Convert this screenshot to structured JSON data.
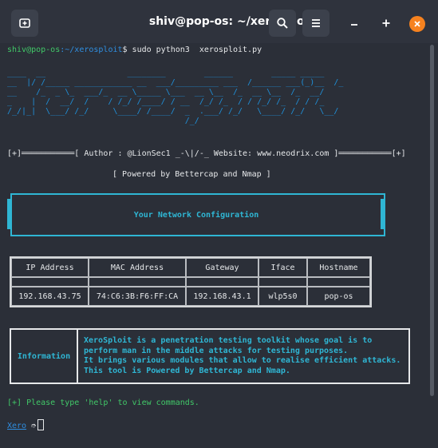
{
  "window": {
    "title": "shiv@pop-os: ~/xerosploit"
  },
  "header": {
    "new_tab_icon": "new-tab-icon",
    "search_icon": "search-icon",
    "menu_icon": "hamburger-menu-icon",
    "minimize_icon": "minimize-icon",
    "maximize_icon": "maximize-icon",
    "close_icon": "close-icon",
    "close_color": "#f6821f"
  },
  "terminal": {
    "prompt_user": "shiv@pop-os",
    "prompt_path": ":~/xerosploit",
    "command": "$ sudo python3  xerosploit.py",
    "ascii_art": "____  __                 ________        ______        _____ _____\n__  |/ /_____ ____________ __  ___/_________ ___  /______ ___(_)__  /_\n__    /_  _ \\_  ___/_  __ \\_____ \\___  __ \\__  /_  __ \\__  /_  __/\n_    |  /  __/  /    / /_/ /____/ / __  /_/ /_  / / /_/ /_  / / /_\n/_/|_|  \\___/ /_/     \\____/ /____/  _  .___/ /_/   \\____/ /_/   \\__/\n                                     /_/",
    "author_line": "[+]═══════════[ Author : @LionSec1 _-\\|/-_ Website: www.neodrix.com ]═══════════[+]",
    "powered_line": "[ Powered by Bettercap and Nmap ]",
    "config_title": "Your Network Configuration",
    "network_table": {
      "headers": [
        "IP Address",
        "MAC Address",
        "Gateway",
        "Iface",
        "Hostname"
      ],
      "row": [
        "192.168.43.75",
        "74:C6:3B:F6:FF:CA",
        "192.168.43.1",
        "wlp5s0",
        "pop-os"
      ]
    },
    "info_label": "Information",
    "info_text": "XeroSploit is a penetration testing toolkit whose goal is to\nperform man in the middle attacks for testing purposes.\nIt brings various modules that allow to realise efficient attacks.\nThis tool is Powered by Bettercap and Nmap.",
    "help_line": "[+] Please type 'help' to view commands.",
    "prompt2_name": "Xero",
    "prompt2_symbol": "➮"
  }
}
